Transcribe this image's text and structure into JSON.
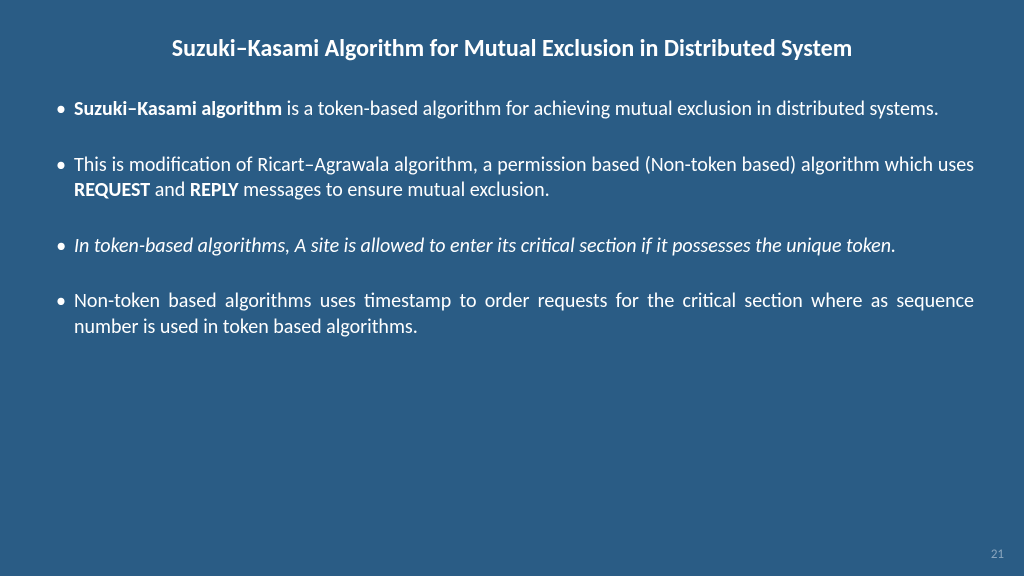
{
  "title": "Suzuki–Kasami Algorithm for Mutual Exclusion in Distributed System",
  "bullets": {
    "b1_strong": "Suzuki–Kasami algorithm",
    "b1_rest": " is a token-based algorithm for achieving mutual exclusion in distributed systems.",
    "b2_a": "This is modification of Ricart–Agrawala algorithm, a permission based (Non-token based) algorithm which uses ",
    "b2_req": "REQUEST",
    "b2_b": " and ",
    "b2_rep": "REPLY",
    "b2_c": " messages to ensure mutual exclusion.",
    "b3": "In token-based algorithms, A site is allowed to enter its critical section if it possesses the unique token.",
    "b4": "Non-token based algorithms uses timestamp to order requests for the critical section where as sequence number is used in token based algorithms."
  },
  "page_number": "21"
}
